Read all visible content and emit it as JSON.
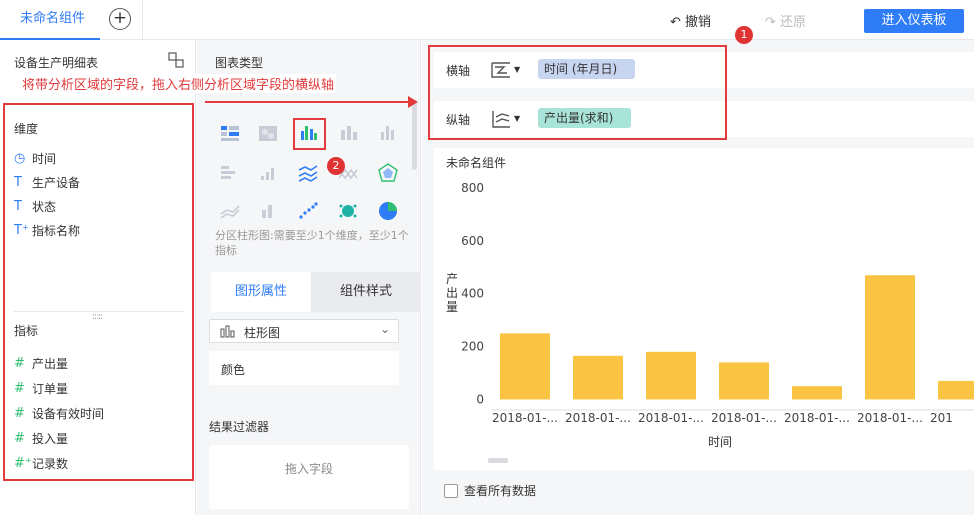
{
  "topbar": {
    "tab_label": "未命名组件",
    "undo_label": "撤销",
    "redo_label": "还原",
    "enter_dashboard_label": "进入仪表板"
  },
  "left_panel": {
    "title": "设备生产明细表",
    "dimensions_header": "维度",
    "dimensions": [
      {
        "label": "时间",
        "icon": "clock-icon"
      },
      {
        "label": "生产设备",
        "icon": "text-field-icon"
      },
      {
        "label": "状态",
        "icon": "text-field-icon"
      },
      {
        "label": "指标名称",
        "icon": "text-field-plus-icon"
      }
    ],
    "measures_header": "指标",
    "measures": [
      {
        "label": "产出量",
        "icon": "hash-icon"
      },
      {
        "label": "订单量",
        "icon": "hash-icon"
      },
      {
        "label": "设备有效时间",
        "icon": "hash-icon"
      },
      {
        "label": "投入量",
        "icon": "hash-icon"
      },
      {
        "label": "记录数",
        "icon": "hash-plus-icon"
      }
    ]
  },
  "middle_panel": {
    "title": "图表类型",
    "chart_type_note": "分区柱形图:需要至少1个维度，至少1个指标",
    "tabs": [
      "图形属性",
      "组件样式"
    ],
    "chart_type_selected": "柱形图",
    "color_label": "颜色",
    "filter_title": "结果过滤器",
    "drop_placeholder": "拖入字段"
  },
  "right_area": {
    "x_axis_label": "横轴",
    "x_axis_field": "时间 (年月日)",
    "y_axis_label": "纵轴",
    "y_axis_field": "产出量(求和)",
    "chart_title": "未命名组件",
    "show_all_label": "查看所有数据"
  },
  "annotations": {
    "instruction": "将带分析区域的字段，拖入右侧分析区域字段的横纵轴",
    "badge_1": "1",
    "badge_2": "2",
    "annotation_color": "#e23b3b"
  },
  "colors": {
    "accent": "#2e7cf6",
    "bar": "#fbc342",
    "pill_x": "#c8d5f0",
    "pill_y": "#a9e4d8"
  },
  "chart_data": {
    "type": "bar",
    "categories": [
      "2018-01-...",
      "2018-01-...",
      "2018-01-...",
      "2018-01-...",
      "2018-01-...",
      "2018-01-...",
      "201"
    ],
    "values": [
      250,
      165,
      180,
      140,
      50,
      470,
      70
    ],
    "xlabel": "时间",
    "ylabel": "产出量",
    "yticks": [
      0,
      200,
      400,
      600,
      800
    ],
    "ylim": [
      -40,
      800
    ],
    "grid": false
  }
}
